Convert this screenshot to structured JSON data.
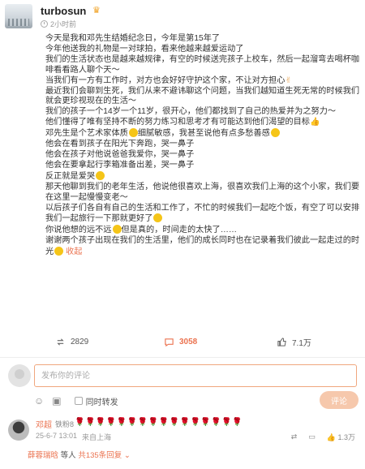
{
  "header": {
    "username": "turbosun",
    "time": "2小时前"
  },
  "post": {
    "lines": [
      "今天是我和邓先生结婚纪念日，今年是第15年了",
      "今年他送我的礼物是一对球拍，看来他越来越爱运动了",
      "我们的生活状态也是越来越规律，有空的时候送完孩子上校车，然后一起溜弯去喝杯咖啡看看路人聊个天～",
      "当我们有一方有工作时，对方也会好好守护这个家，不让对方担心",
      "最近我们会聊到生死，我们从来不避讳聊这个问题，当我们越知道生死无常的时候我们就会更珍视现在的生活～",
      "我们的孩子一个14岁一个11岁，很开心，他们都找到了自己的热爱并为之努力～",
      "他们懂得了唯有坚持不断的努力练习和思考才有可能达到他们渴望的目标",
      "邓先生是个艺术家体质",
      "细腻敏感，我甚至说他有点多愁善感",
      "他会在看到孩子在阳光下奔跑，哭一鼻子",
      "他会在孩子对他说爸爸我爱你，哭一鼻子",
      "他会在要拿起行李箱准备出差，哭一鼻子",
      "反正就是爱哭",
      "那天他聊到我们的老年生活，他说他很喜欢上海，很喜欢我们上海的这个小家，我们要在这里一起慢慢变老～",
      "以后孩子们各自有自己的生活和工作了，不忙的时候我们一起吃个饭，有空了可以安排我们一起旅行一下那就更好了",
      "你说他想的远不远",
      "但是真的，时间走的太快了……",
      "谢谢两个孩子出现在我们的生活里，他们的成长同时也在记录着我们彼此一起走过的时光",
      "收起"
    ]
  },
  "stats": {
    "reposts": "2829",
    "comments": "3058",
    "likes": "7.1万"
  },
  "comment_box": {
    "placeholder": "发布你的评论",
    "repost_label": "同时转发",
    "submit_label": "评论"
  },
  "reply": {
    "name": "邓超",
    "badge": "铁粉8",
    "content": "🌹🌹🌹🌹🌹🌹🌹🌹🌹🌹🌹🌹🌹🌹🌹🌹",
    "time": "25-6-7 13:01",
    "location": "来自上海",
    "like_count": "1.3万",
    "liked_by_name": "薛蓉瑞晗",
    "liked_by_rest": "等人",
    "reply_total": "共135条回复"
  },
  "colors": {
    "accent": "#eb7350",
    "input_border": "#f0a77e",
    "submit_bg": "#f6c8ac"
  }
}
